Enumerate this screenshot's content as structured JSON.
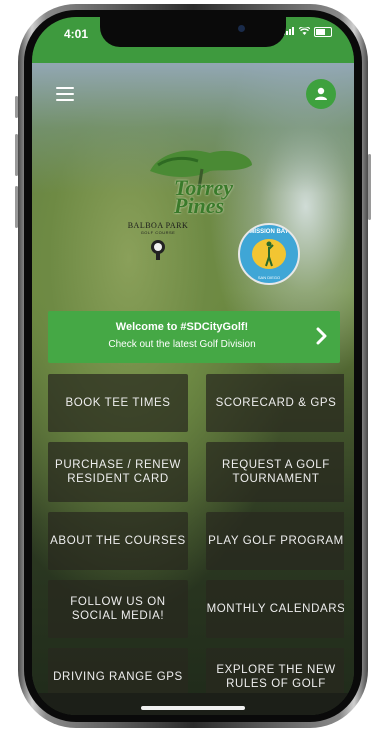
{
  "status_bar": {
    "time": "4:01",
    "signal_icon": "signal-icon",
    "wifi_icon": "wifi-icon",
    "battery_icon": "battery-icon"
  },
  "header": {
    "menu_icon": "hamburger-menu-icon",
    "profile_icon": "user-profile-icon"
  },
  "logos": {
    "torrey_pines": "Torrey Pines",
    "balboa_park": "BALBOA PARK",
    "balboa_park_sub": "GOLF COURSE",
    "mission_bay_top": "MISSION BAY",
    "mission_bay_bottom": "SAN DIEGO"
  },
  "banner": {
    "line1": "Welcome to #SDCityGolf!",
    "line2": "Check out the latest Golf Division",
    "chevron_icon": "chevron-right-icon"
  },
  "tiles": [
    {
      "label": "BOOK TEE TIMES"
    },
    {
      "label": "SCORECARD & GPS"
    },
    {
      "label": "PURCHASE / RENEW RESIDENT CARD"
    },
    {
      "label": "REQUEST A GOLF TOURNAMENT"
    },
    {
      "label": "ABOUT THE COURSES"
    },
    {
      "label": "PLAY GOLF PROGRAM"
    },
    {
      "label": "FOLLOW US ON SOCIAL MEDIA!"
    },
    {
      "label": "MONTHLY CALENDARS"
    },
    {
      "label": "DRIVING RANGE GPS"
    },
    {
      "label": "EXPLORE THE NEW RULES OF GOLF"
    }
  ],
  "colors": {
    "brand_green": "#45a845",
    "status_green": "#3e9a3e",
    "tile_bg": "#28281e"
  }
}
